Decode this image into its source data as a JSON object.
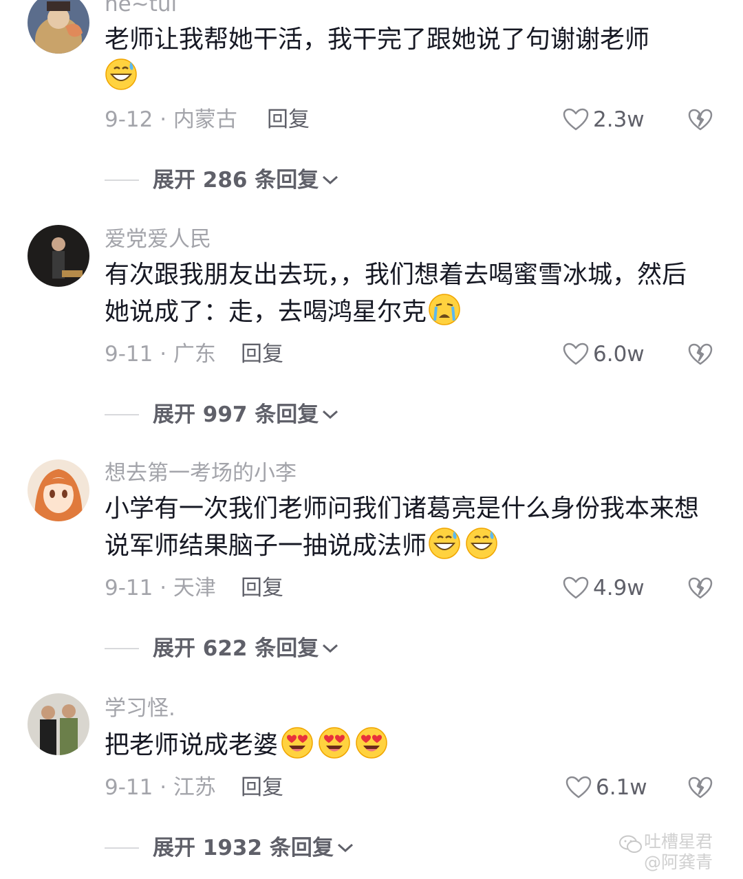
{
  "comments": [
    {
      "username": "ne~tui",
      "text": "老师让我帮她干活，我干完了跟她说了句谢谢老师",
      "emojis": [
        "grin-sweat-emoji"
      ],
      "date_location": "9-12 · 内蒙古",
      "reply_label": "回复",
      "likes": "2.3w",
      "expand_label": "展开 286 条回复"
    },
    {
      "username": "爱党爱人民",
      "text": "有次跟我朋友出去玩，，我们想着去喝蜜雪冰城，然后她说成了：走，去喝鸿星尔克",
      "emojis": [
        "crying-emoji"
      ],
      "date_location": "9-11 · 广东",
      "reply_label": "回复",
      "likes": "6.0w",
      "expand_label": "展开 997 条回复"
    },
    {
      "username": "想去第一考场的小李",
      "text": "小学有一次我们老师问我们诸葛亮是什么身份我本来想说军师结果脑子一抽说成法师",
      "emojis": [
        "grin-sweat-emoji",
        "grin-sweat-emoji"
      ],
      "date_location": "9-11 · 天津",
      "reply_label": "回复",
      "likes": "4.9w",
      "expand_label": "展开 622 条回复"
    },
    {
      "username": "学习怪.",
      "text": "把老师说成老婆",
      "emojis": [
        "heart-eyes-emoji",
        "heart-eyes-emoji",
        "heart-eyes-emoji"
      ],
      "date_location": "9-11 · 江苏",
      "reply_label": "回复",
      "likes": "6.1w",
      "expand_label": "展开 1932 条回复"
    }
  ],
  "watermark": {
    "line1": "吐槽星君",
    "line2": "@阿龚青"
  },
  "colors": {
    "text": "#161823",
    "secondary": "#a3a4aa",
    "action": "#5f6069",
    "divider": "#d8d9dc"
  }
}
